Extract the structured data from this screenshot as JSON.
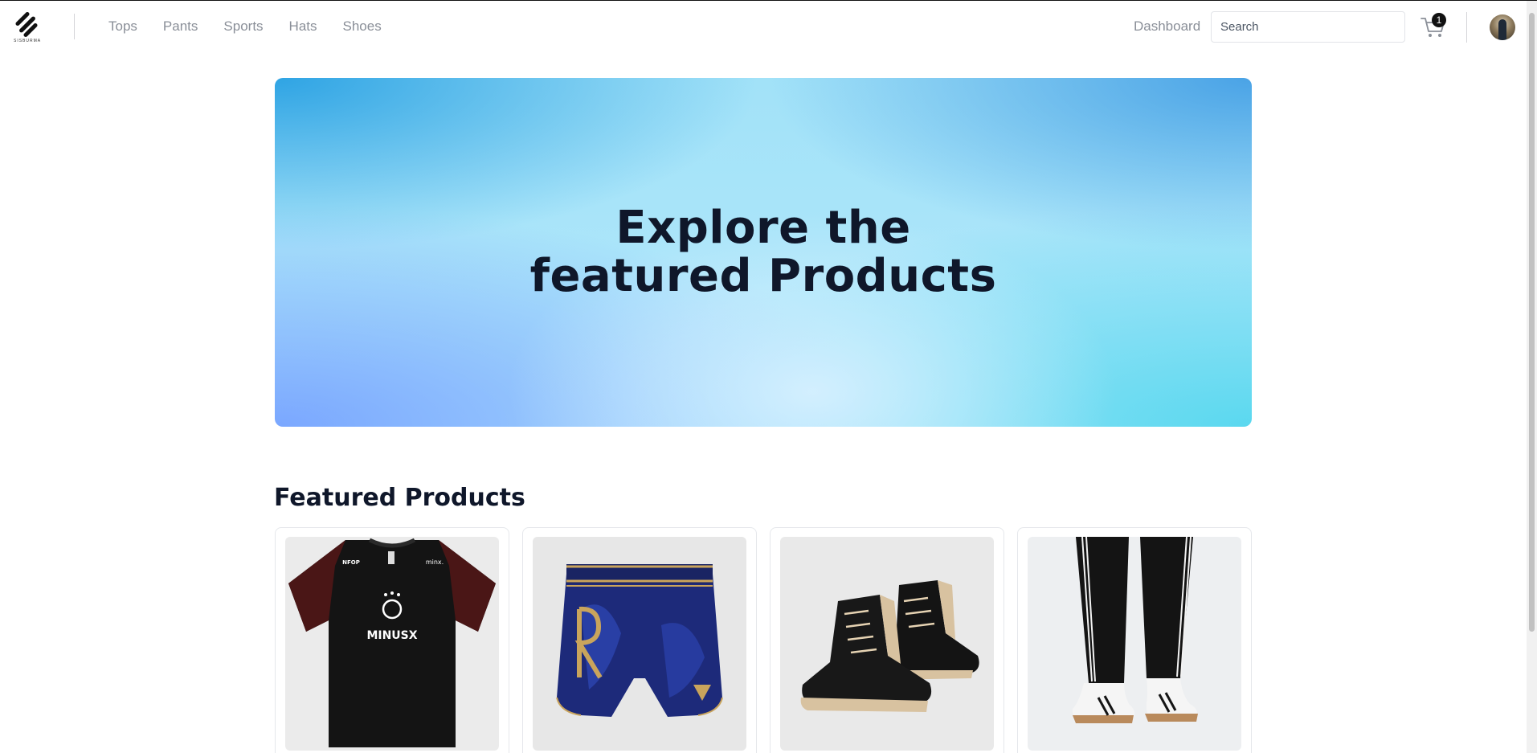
{
  "brand": {
    "name": "SISBURMA"
  },
  "nav": {
    "items": [
      {
        "label": "Tops"
      },
      {
        "label": "Pants"
      },
      {
        "label": "Sports"
      },
      {
        "label": "Hats"
      },
      {
        "label": "Shoes"
      }
    ],
    "dashboard_label": "Dashboard"
  },
  "search": {
    "placeholder": "Search",
    "value": ""
  },
  "cart": {
    "count": "1",
    "icon": "cart-icon"
  },
  "hero": {
    "line1": "Explore the",
    "line2": "featured Products"
  },
  "featured": {
    "title": "Featured Products",
    "products": [
      {
        "image": "black jersey shirt",
        "shirt_text": "MINUSX",
        "left_tag": "NFOP",
        "right_tag": "minx."
      },
      {
        "image": "blue muay thai shorts"
      },
      {
        "image": "black and tan boxing shoes"
      },
      {
        "image": "black track pants with white sneakers"
      }
    ]
  },
  "colors": {
    "nav_text": "#8a8f98",
    "heading": "#0f172a",
    "hero_accent": "#a2e2f8"
  }
}
